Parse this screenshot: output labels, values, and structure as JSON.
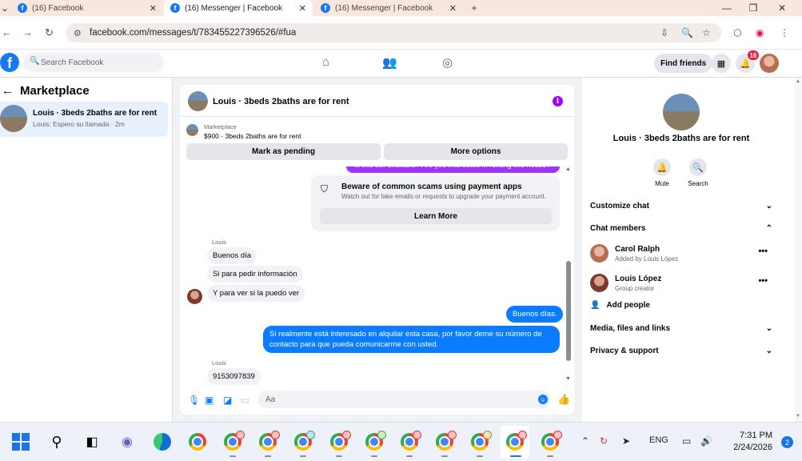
{
  "browser": {
    "tabs": [
      {
        "title": "(16) Facebook",
        "active": false
      },
      {
        "title": "(16) Messenger | Facebook",
        "active": true
      },
      {
        "title": "(16) Messenger | Facebook",
        "active": false
      }
    ],
    "url": "facebook.com/messages/t/783455227396526/#fua"
  },
  "fb_header": {
    "logo": "f",
    "search_placeholder": "Search Facebook",
    "find_friends": "Find friends",
    "notification_count": "16"
  },
  "left_pane": {
    "title": "Marketplace",
    "threads": [
      {
        "name": "Louis · 3beds 2baths are for rent",
        "preview": "Louis: Espero su llamada · 2m"
      }
    ]
  },
  "chat": {
    "title": "Louis · 3beds 2baths are for rent",
    "marketplace_label": "Marketplace",
    "listing": "$900 - 3beds 2baths are for rent",
    "mark_pending": "Mark as pending",
    "more_options": "More options",
    "cut_message": "Is this still available? Are you interested in renting this house?",
    "scam_title": "Beware of common scams using payment apps",
    "scam_sub": "Watch out for fake emails or requests to upgrade your payment account.",
    "learn_more": "Learn More",
    "sender": "Louis",
    "incoming_1": [
      "Buenos día",
      "Si para pedir información",
      "Y para ver si la puedo ver"
    ],
    "outgoing_1": "Buenos días.",
    "outgoing_2": "Si realmente está interesado en alquilar esta casa, por favor deme su número de contacto para que pueda comunicarme con usted.",
    "incoming_2": [
      "9153097839"
    ],
    "composer_placeholder": "Aa"
  },
  "info_pane": {
    "name": "Louis · 3beds 2baths are for rent",
    "actions": [
      {
        "label": "Mute",
        "icon": "bell-icon"
      },
      {
        "label": "Search",
        "icon": "search-icon"
      }
    ],
    "sections": {
      "customize": "Customize chat",
      "members": "Chat members",
      "media": "Media, files and links",
      "privacy": "Privacy & support"
    },
    "members": [
      {
        "name": "Carol Ralph",
        "sub": "Added by Louis López"
      },
      {
        "name": "Louis López",
        "sub": "Group creator"
      }
    ],
    "add_people": "Add people"
  },
  "taskbar": {
    "language": "ENG",
    "time": "7:31 PM",
    "date": "2/24/2026",
    "notification_count": "2"
  },
  "colors": {
    "fb_blue": "#1877f2",
    "outgoing_bubble": "#0a7cff",
    "accent_purple": "#a100ff"
  }
}
